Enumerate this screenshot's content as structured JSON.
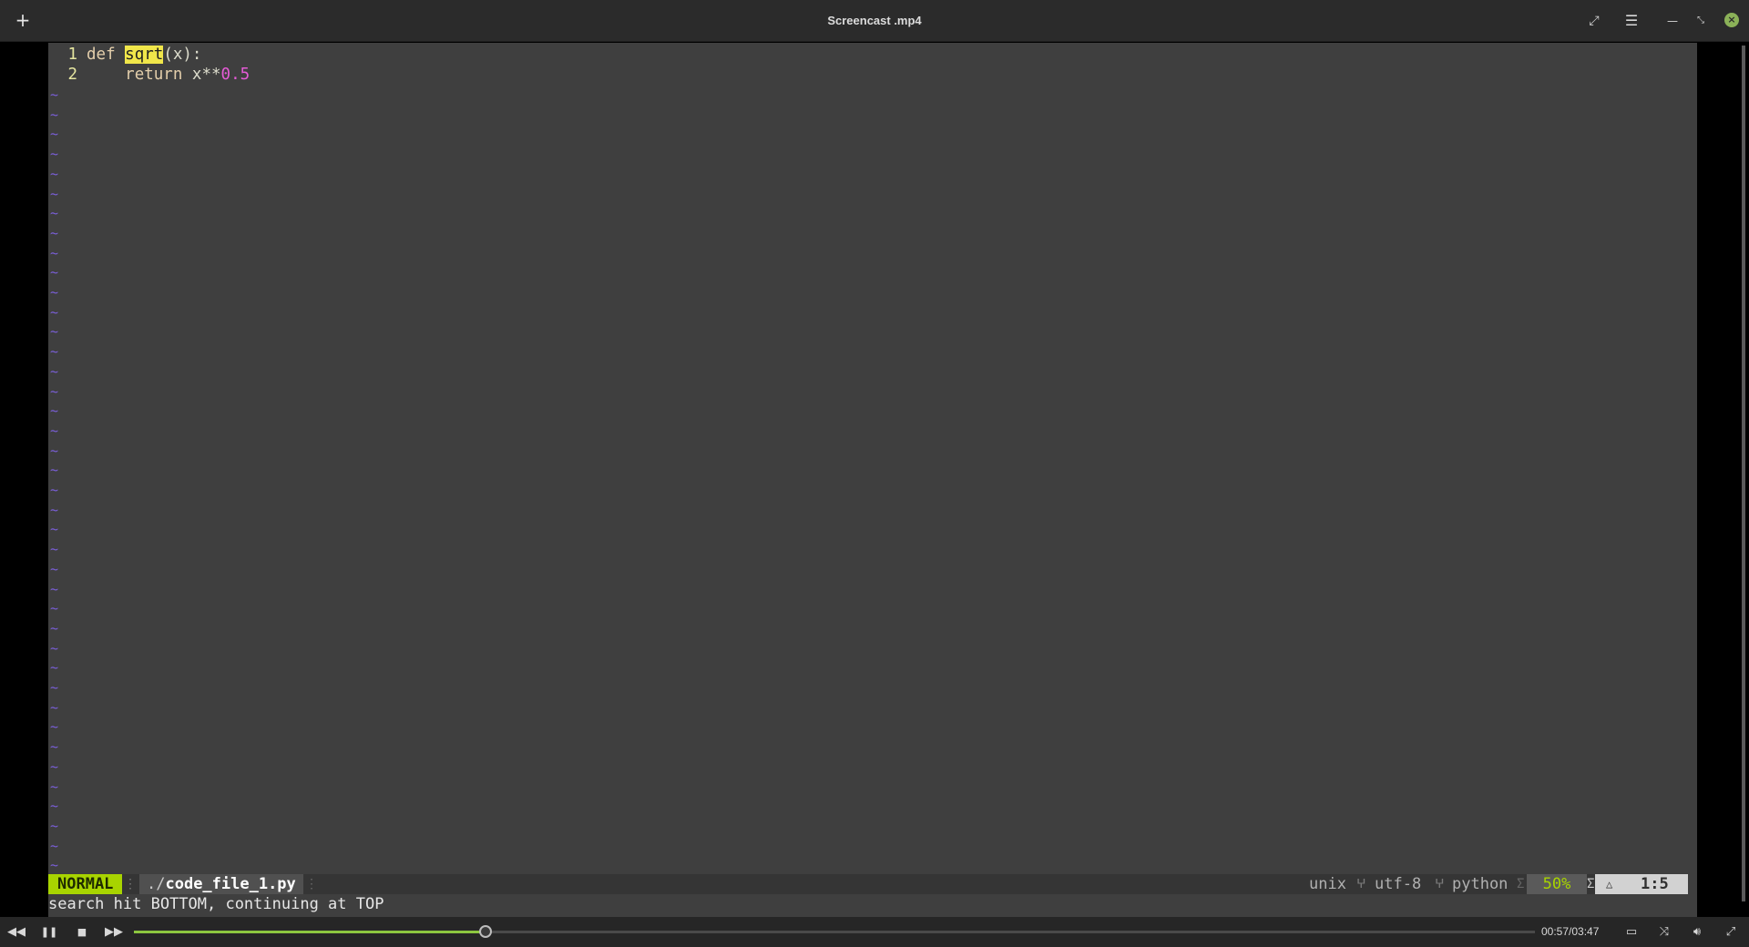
{
  "window": {
    "title": "Screencast .mp4",
    "icons": {
      "add": "plus-icon",
      "fullscreen": "expand-icon",
      "menu": "hamburger-menu-icon",
      "minimize": "minimize-icon",
      "restore": "restore-icon",
      "close": "close-icon"
    }
  },
  "editor": {
    "lines": [
      {
        "number": "1",
        "kw": "def",
        "space": " ",
        "match": "sqrt",
        "rest": "(x):"
      },
      {
        "number": "2",
        "indent": "    ",
        "kw": "return",
        "mid": " x**",
        "num": "0.5"
      }
    ],
    "empty_line_marker": "~",
    "search_highlight_color": "#f0e64a"
  },
  "statusline": {
    "mode": "NORMAL",
    "file_dir": "./",
    "file_name": "code_file_1.py",
    "fileformat": "unix",
    "encoding": "utf-8",
    "filetype": "python",
    "percent": "50%",
    "position": "1:5"
  },
  "cmdline": {
    "message": "search hit BOTTOM, continuing at TOP"
  },
  "player": {
    "time": "00:57/03:47",
    "progress_fraction": 0.2511,
    "icons": {
      "rewind": "rewind-icon",
      "pause": "pause-icon",
      "stop": "stop-icon",
      "forward": "fast-forward-icon",
      "subtitles": "subtitles-icon",
      "shuffle": "shuffle-icon",
      "volume": "volume-icon",
      "fullscreen": "fullscreen-icon"
    },
    "accent_color": "#8cc63f"
  }
}
